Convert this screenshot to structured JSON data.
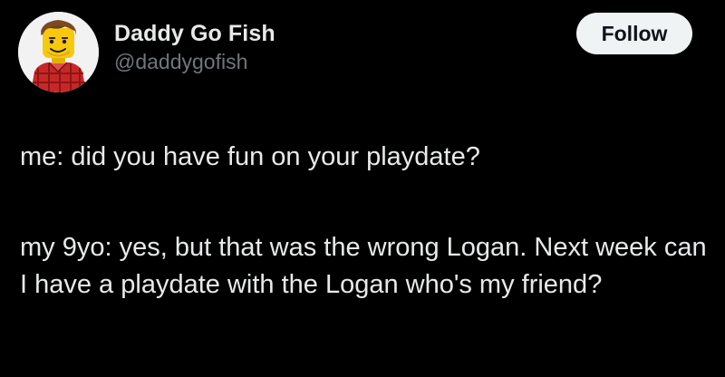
{
  "author": {
    "display_name": "Daddy Go Fish",
    "handle": "@daddygofish",
    "avatar_icon": "lego-minifigure-avatar"
  },
  "follow_button": {
    "label": "Follow"
  },
  "tweet": {
    "paragraphs": [
      "me: did you have fun on your playdate?",
      "my 9yo: yes, but that was the wrong Logan. Next week can I have a playdate with the Logan who's my friend?"
    ]
  },
  "colors": {
    "background": "#000000",
    "primary_text": "#e7e9ea",
    "secondary_text": "#71767b",
    "button_bg": "#eff3f4",
    "button_text": "#0f1419"
  }
}
